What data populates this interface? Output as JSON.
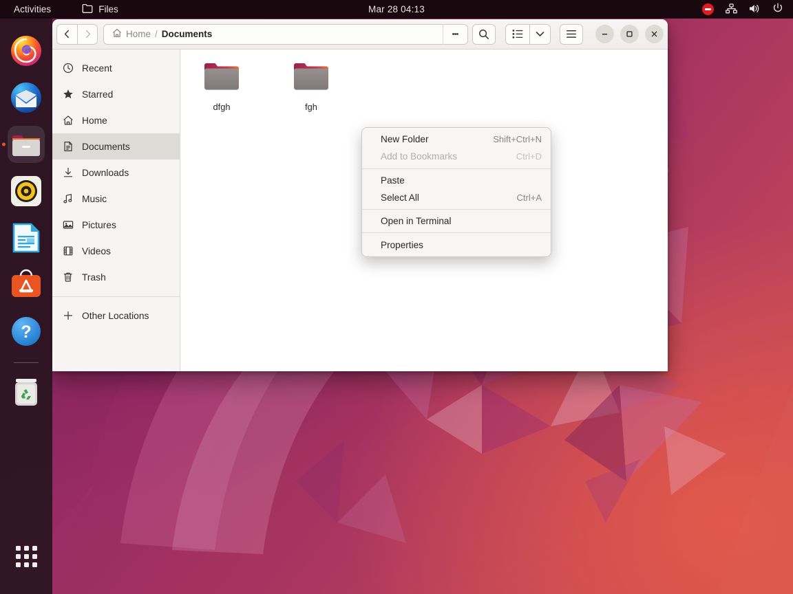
{
  "topbar": {
    "activities": "Activities",
    "app_name": "Files",
    "app_icon": "folder-icon",
    "clock": "Mar 28  04:13",
    "tray": [
      {
        "name": "do-not-disturb-icon",
        "label": "Do Not Disturb"
      },
      {
        "name": "network-wired-icon",
        "label": "Network"
      },
      {
        "name": "volume-icon",
        "label": "Volume"
      },
      {
        "name": "power-icon",
        "label": "Power"
      }
    ]
  },
  "dock": {
    "items": [
      {
        "name": "firefox",
        "label": "Firefox",
        "active": false
      },
      {
        "name": "thunderbird",
        "label": "Thunderbird",
        "active": false
      },
      {
        "name": "files",
        "label": "Files",
        "active": true
      },
      {
        "name": "rhythmbox",
        "label": "Rhythmbox",
        "active": false
      },
      {
        "name": "libreoffice-writer",
        "label": "LibreOffice Writer",
        "active": false
      },
      {
        "name": "ubuntu-software",
        "label": "Ubuntu Software",
        "active": false
      },
      {
        "name": "help",
        "label": "Help",
        "active": false
      },
      {
        "name": "trash",
        "label": "Trash",
        "active": false
      }
    ],
    "show_applications": "Show Applications"
  },
  "window": {
    "headerbar": {
      "back_label": "Back",
      "forward_label": "Forward",
      "breadcrumb": [
        {
          "label": "Home",
          "current": false,
          "icon": "home-icon"
        },
        {
          "label": "Documents",
          "current": true,
          "icon": ""
        }
      ],
      "separator": "/",
      "path_menu_label": "Path options",
      "search_label": "Search",
      "view_list_label": "List view",
      "view_options_label": "View options",
      "main_menu_label": "Main menu",
      "minimize_label": "Minimize",
      "maximize_label": "Maximize",
      "close_label": "Close"
    },
    "sidebar": {
      "items": [
        {
          "label": "Recent",
          "icon": "clock-icon",
          "selected": false
        },
        {
          "label": "Starred",
          "icon": "star-icon",
          "selected": false
        },
        {
          "label": "Home",
          "icon": "home-icon",
          "selected": false
        },
        {
          "label": "Documents",
          "icon": "document-icon",
          "selected": true
        },
        {
          "label": "Downloads",
          "icon": "download-icon",
          "selected": false
        },
        {
          "label": "Music",
          "icon": "music-icon",
          "selected": false
        },
        {
          "label": "Pictures",
          "icon": "image-icon",
          "selected": false
        },
        {
          "label": "Videos",
          "icon": "video-icon",
          "selected": false
        },
        {
          "label": "Trash",
          "icon": "trash-icon",
          "selected": false
        }
      ],
      "other_locations": {
        "label": "Other Locations",
        "icon": "plus-icon"
      }
    },
    "content": {
      "files": [
        {
          "name": "dfgh",
          "type": "folder"
        },
        {
          "name": "fgh",
          "type": "folder"
        }
      ]
    }
  },
  "context_menu": {
    "groups": [
      [
        {
          "label": "New Folder",
          "accel": "Shift+Ctrl+N",
          "disabled": false
        },
        {
          "label": "Add to Bookmarks",
          "accel": "Ctrl+D",
          "disabled": true
        }
      ],
      [
        {
          "label": "Paste",
          "accel": "",
          "disabled": false
        },
        {
          "label": "Select All",
          "accel": "Ctrl+A",
          "disabled": false
        }
      ],
      [
        {
          "label": "Open in Terminal",
          "accel": "",
          "disabled": false
        }
      ],
      [
        {
          "label": "Properties",
          "accel": "",
          "disabled": false
        }
      ]
    ]
  },
  "colors": {
    "accent": "#e95420",
    "topbar_bg": "#19080e",
    "dock_bg": "#281520",
    "sidebar_bg": "#f6f5f4",
    "selected_bg": "#dedad6",
    "menu_bg": "#f7f6f5",
    "folder_body": "#8a8483",
    "folder_tab": "#a0204f",
    "folder_accent": "#e8712c",
    "dnd_red": "#e01b24"
  }
}
